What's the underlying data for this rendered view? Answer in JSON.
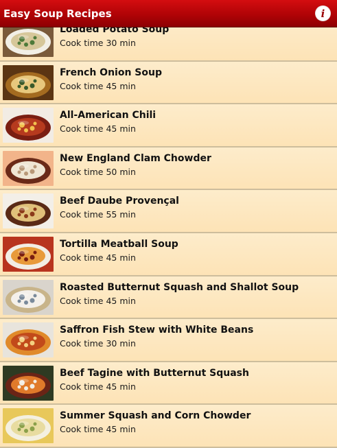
{
  "header": {
    "title": "Easy Soup Recipes",
    "info_icon": "info-icon",
    "info_glyph": "i",
    "colors": {
      "bar": "#b00306",
      "text": "#ffffff"
    }
  },
  "recipes": [
    {
      "name": "Loaded Potato Soup",
      "cook_time": "Cook time 30 min",
      "image_icon": "loaded-potato-soup-photo",
      "colors": [
        "#7a5a3a",
        "#f2efe6",
        "#d6c79a",
        "#4e7a3a"
      ]
    },
    {
      "name": "French Onion Soup",
      "cook_time": "Cook time 45 min",
      "image_icon": "french-onion-soup-photo",
      "colors": [
        "#5b3513",
        "#a46b20",
        "#e8c87d",
        "#3a5a2a"
      ]
    },
    {
      "name": "All-American Chili",
      "cook_time": "Cook time 45 min",
      "image_icon": "chili-photo",
      "colors": [
        "#f2ece4",
        "#7a1e12",
        "#b63a1e",
        "#f2c14e"
      ]
    },
    {
      "name": "New England Clam Chowder",
      "cook_time": "Cook time 50 min",
      "image_icon": "clam-chowder-photo",
      "colors": [
        "#f2b48a",
        "#6a2a18",
        "#efe6d4",
        "#b89878"
      ]
    },
    {
      "name": "Beef Daube Provençal",
      "cook_time": "Cook time 55 min",
      "image_icon": "beef-daube-photo",
      "colors": [
        "#f3efe8",
        "#5a2a16",
        "#e0c07a",
        "#8b3a1a"
      ]
    },
    {
      "name": "Tortilla Meatball Soup",
      "cook_time": "Cook time 45 min",
      "image_icon": "tortilla-meatball-soup-photo",
      "colors": [
        "#b8341e",
        "#f2ede4",
        "#e89a3a",
        "#7a1e10"
      ]
    },
    {
      "name": "Roasted Butternut Squash and Shallot Soup",
      "cook_time": "Cook time 45 min",
      "image_icon": "butternut-squash-soup-photo",
      "colors": [
        "#d9d4cc",
        "#c8b48a",
        "#f4f0ea",
        "#7a8a9a"
      ]
    },
    {
      "name": "Saffron Fish Stew with White Beans",
      "cook_time": "Cook time 30 min",
      "image_icon": "saffron-fish-stew-photo",
      "colors": [
        "#e8e4dc",
        "#e08a2a",
        "#c24a1a",
        "#f4d080"
      ]
    },
    {
      "name": "Beef Tagine with Butternut Squash",
      "cook_time": "Cook time 45 min",
      "image_icon": "beef-tagine-photo",
      "colors": [
        "#2e3a22",
        "#6a2416",
        "#e07a2a",
        "#f2ede4"
      ]
    },
    {
      "name": "Summer Squash and Corn Chowder",
      "cook_time": "Cook time 45 min",
      "image_icon": "corn-chowder-photo",
      "colors": [
        "#e8c85a",
        "#f4f0e0",
        "#e8dca0",
        "#8aa04a"
      ]
    }
  ]
}
